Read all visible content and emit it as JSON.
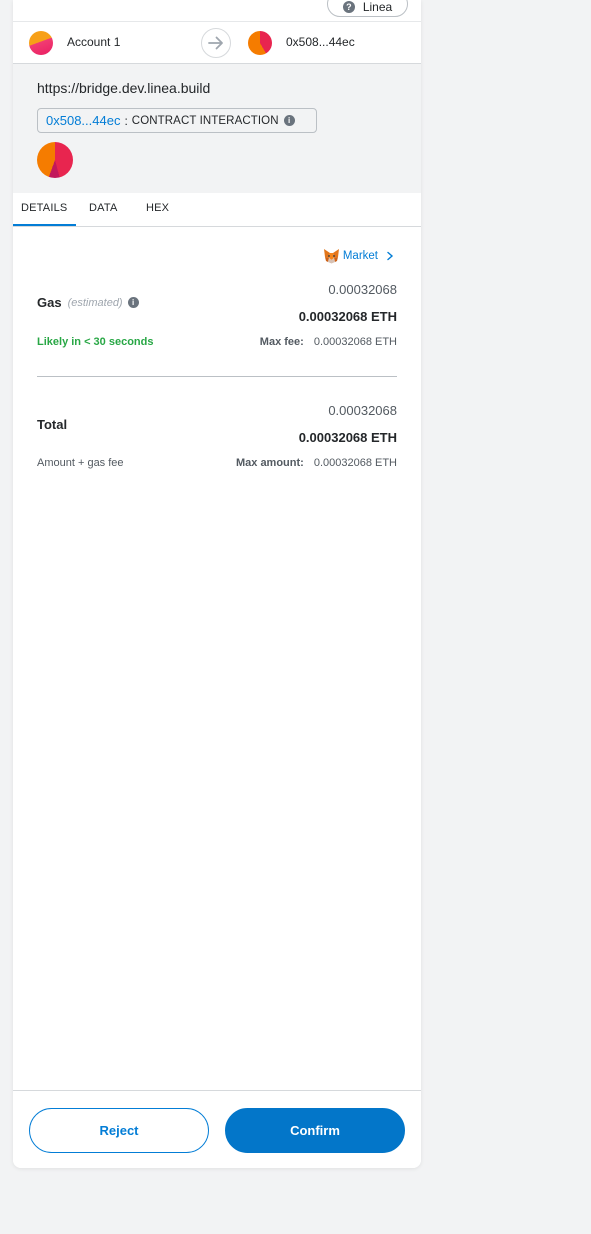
{
  "network": {
    "name": "Linea",
    "icon": "question-icon"
  },
  "sender": {
    "name": "Account 1"
  },
  "recipient": {
    "address": "0x508...44ec"
  },
  "origin": {
    "url": "https://bridge.dev.linea.build",
    "contract_address": "0x508...44ec",
    "separator": ":",
    "contract_type": "CONTRACT INTERACTION"
  },
  "tabs": [
    {
      "label": "DETAILS",
      "active": true
    },
    {
      "label": "DATA",
      "active": false
    },
    {
      "label": "HEX",
      "active": false
    }
  ],
  "gas": {
    "market_label": "Market",
    "label": "Gas",
    "estimated_label": "(estimated)",
    "value": "0.00032068",
    "value_eth": "0.00032068 ETH",
    "likely": "Likely in < 30 seconds",
    "max_fee_label": "Max fee:",
    "max_fee_value": "0.00032068 ETH"
  },
  "total": {
    "label": "Total",
    "value": "0.00032068",
    "value_eth": "0.00032068 ETH",
    "sub_label": "Amount + gas fee",
    "max_amount_label": "Max amount:",
    "max_amount_value": "0.00032068 ETH"
  },
  "footer": {
    "reject_label": "Reject",
    "confirm_label": "Confirm"
  },
  "colors": {
    "accent": "#037dd6",
    "success": "#28a745",
    "background": "#f2f3f4"
  }
}
